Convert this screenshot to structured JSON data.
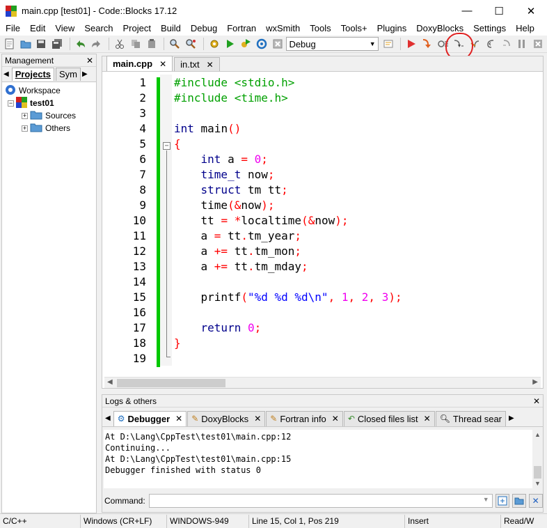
{
  "window": {
    "title": "main.cpp [test01] - Code::Blocks 17.12",
    "minimize": "—",
    "maximize": "☐",
    "close": "✕"
  },
  "menu": [
    "File",
    "Edit",
    "View",
    "Search",
    "Project",
    "Build",
    "Debug",
    "Fortran",
    "wxSmith",
    "Tools",
    "Tools+",
    "Plugins",
    "DoxyBlocks",
    "Settings",
    "Help"
  ],
  "toolbar": {
    "build_target": "Debug"
  },
  "management": {
    "title": "Management",
    "tabs": [
      "Projects",
      "Sym"
    ],
    "tree": {
      "workspace": "Workspace",
      "project": "test01",
      "folders": [
        "Sources",
        "Others"
      ]
    }
  },
  "editor": {
    "tabs": [
      "main.cpp",
      "in.txt"
    ],
    "line_numbers": [
      "1",
      "2",
      "3",
      "4",
      "5",
      "6",
      "7",
      "8",
      "9",
      "10",
      "11",
      "12",
      "13",
      "14",
      "15",
      "16",
      "17",
      "18",
      "19"
    ]
  },
  "logs": {
    "title": "Logs & others",
    "tabs": [
      "Debugger",
      "DoxyBlocks",
      "Fortran info",
      "Closed files list",
      "Thread sear"
    ],
    "lines": [
      "At D:\\Lang\\CppTest\\test01\\main.cpp:12",
      "Continuing...",
      "At D:\\Lang\\CppTest\\test01\\main.cpp:15",
      "Debugger finished with status 0"
    ],
    "command_label": "Command:"
  },
  "status": {
    "language": "C/C++",
    "eol": "Windows (CR+LF)",
    "encoding": "WINDOWS-949",
    "position": "Line 15, Col 1, Pos 219",
    "mode": "Insert",
    "access": "Read/W"
  },
  "colors": {
    "preprocessor": "#00a000",
    "keyword": "#00008b",
    "operator": "#ff0000",
    "number": "#f000f0",
    "string": "#0000ff",
    "change_bar": "#00c800",
    "annotation": "#e02020"
  }
}
